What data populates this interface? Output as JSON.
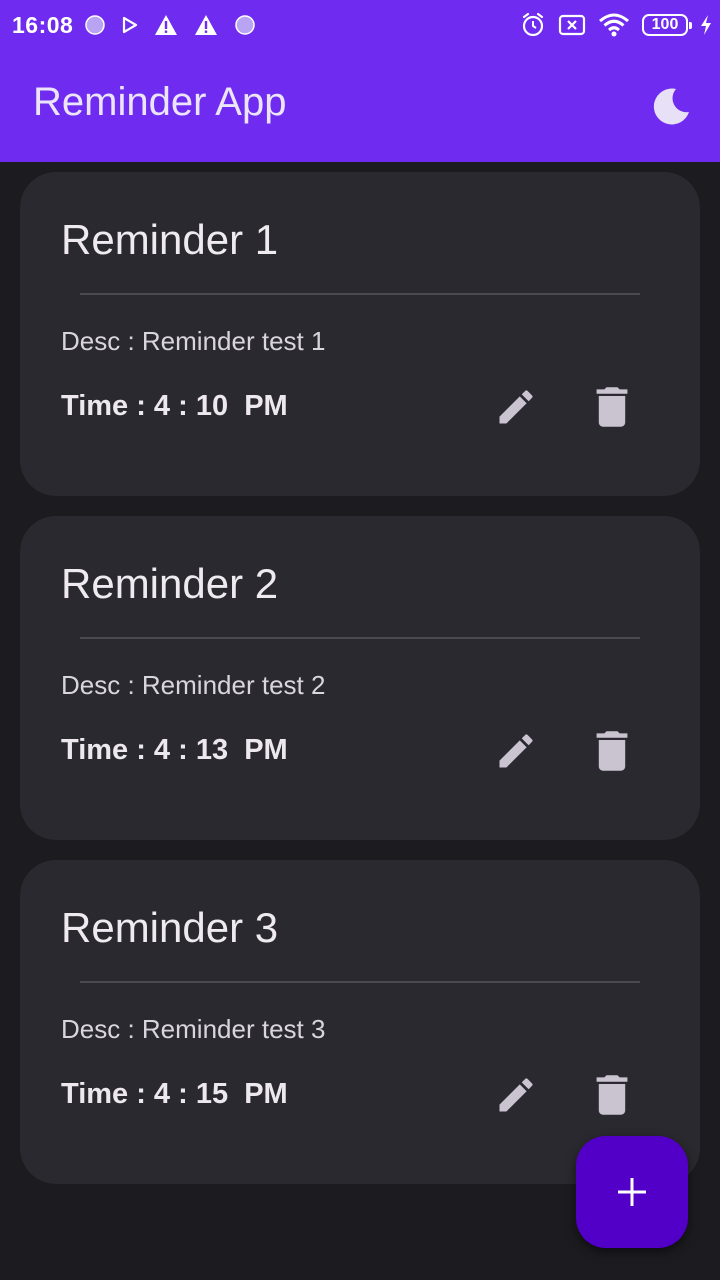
{
  "status_bar": {
    "time": "16:08",
    "battery": "100",
    "left_icons": [
      "notification-dot-icon",
      "play-store-icon",
      "warning-icon",
      "warning-icon",
      "notification-dot-icon"
    ],
    "right_icons": [
      "alarm-icon",
      "sim-x-icon",
      "wifi-icon",
      "battery-icon",
      "charging-icon"
    ]
  },
  "app_bar": {
    "title": "Reminder App",
    "theme_icon": "moon-icon",
    "color": "#6f2bef"
  },
  "reminders": [
    {
      "title": "Reminder 1",
      "desc": "Desc : Reminder test 1",
      "time": "Time : 4 : 10  PM"
    },
    {
      "title": "Reminder 2",
      "desc": "Desc : Reminder test 2",
      "time": "Time : 4 : 13  PM"
    },
    {
      "title": "Reminder 3",
      "desc": "Desc : Reminder test 3",
      "time": "Time : 4 : 15  PM"
    }
  ],
  "fab": {
    "icon": "plus-icon",
    "color": "#5200c8"
  },
  "colors": {
    "background": "#1c1b1f",
    "card": "#2a292f",
    "icon": "#cac4d0"
  }
}
